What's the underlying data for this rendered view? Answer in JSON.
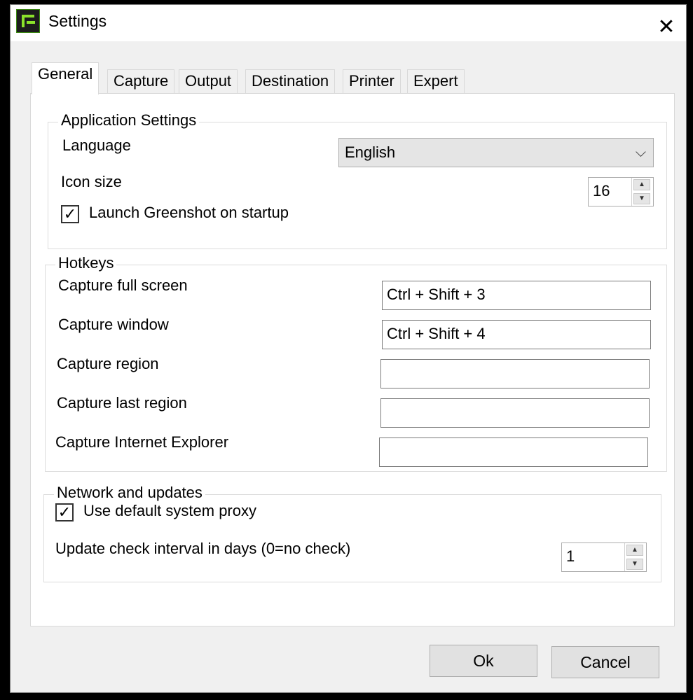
{
  "window": {
    "title": "Settings",
    "close_glyph": "✕"
  },
  "tabs": [
    {
      "label": "General",
      "active": true
    },
    {
      "label": "Capture"
    },
    {
      "label": "Output"
    },
    {
      "label": "Destination"
    },
    {
      "label": "Printer"
    },
    {
      "label": "Expert"
    }
  ],
  "application_settings": {
    "legend": "Application Settings",
    "language_label": "Language",
    "language_value": "English",
    "icon_size_label": "Icon size",
    "icon_size_value": "16",
    "launch_on_startup_label": "Launch Greenshot on startup",
    "launch_on_startup_checked": true
  },
  "hotkeys": {
    "legend": "Hotkeys",
    "items": [
      {
        "label": "Capture full screen",
        "value": "Ctrl + Shift + 3"
      },
      {
        "label": "Capture window",
        "value": "Ctrl + Shift + 4"
      },
      {
        "label": "Capture region",
        "value": ""
      },
      {
        "label": "Capture last region",
        "value": ""
      },
      {
        "label": "Capture Internet Explorer",
        "value": ""
      }
    ]
  },
  "network": {
    "legend": "Network and updates",
    "proxy_label": "Use default system proxy",
    "proxy_checked": true,
    "update_interval_label": "Update check interval in days (0=no check)",
    "update_interval_value": "1"
  },
  "buttons": {
    "ok": "Ok",
    "cancel": "Cancel"
  },
  "glyphs": {
    "check": "✓",
    "chevron_down": "⌵",
    "spin_up": "▲",
    "spin_down": "▼"
  }
}
